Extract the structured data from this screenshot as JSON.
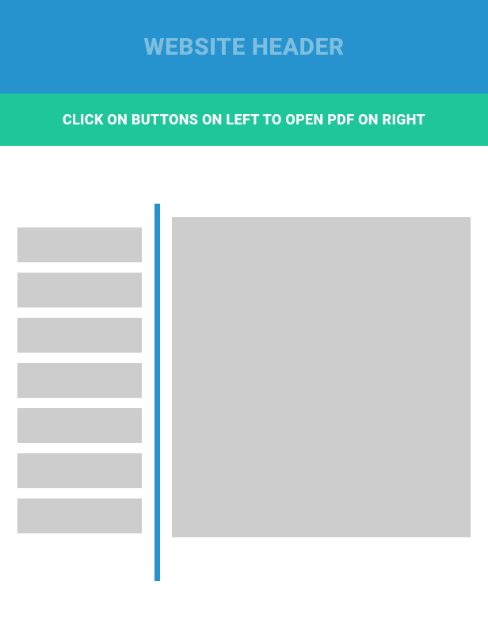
{
  "header": {
    "title": "WEBSITE HEADER"
  },
  "subheader": {
    "text": "CLICK ON BUTTONS ON LEFT TO OPEN PDF ON RIGHT"
  },
  "leftPanel": {
    "buttons": [
      {
        "label": ""
      },
      {
        "label": ""
      },
      {
        "label": ""
      },
      {
        "label": ""
      },
      {
        "label": ""
      },
      {
        "label": ""
      },
      {
        "label": ""
      }
    ]
  },
  "colors": {
    "headerBg": "#2693cf",
    "headerText": "#7ebfe0",
    "subheaderBg": "#1fc69a",
    "subheaderText": "#ffffff",
    "placeholder": "#cdcdcd",
    "divider": "#2693cf"
  }
}
